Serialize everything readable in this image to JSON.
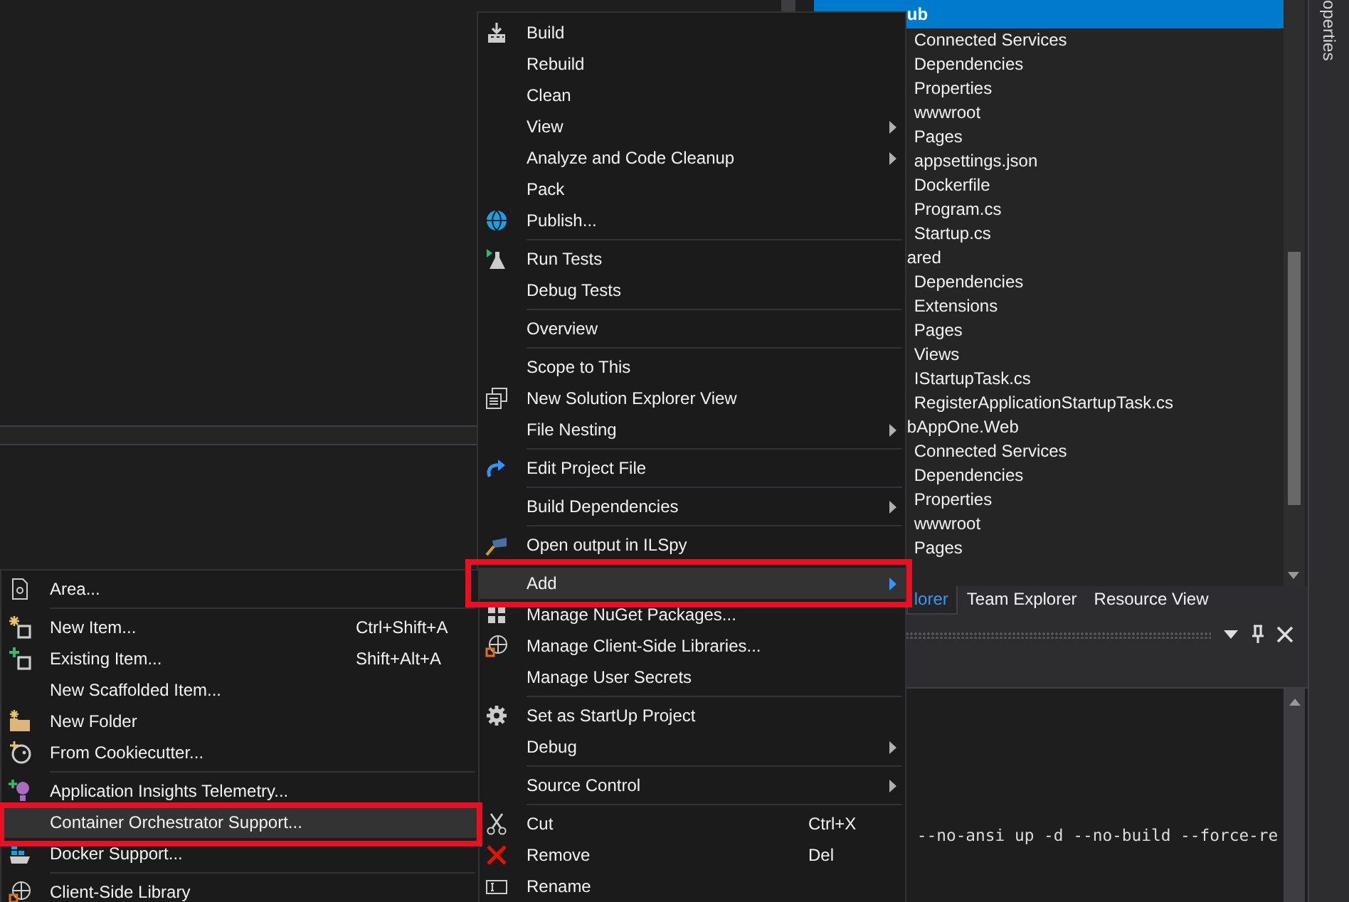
{
  "context_menu": {
    "items": [
      {
        "kind": "build",
        "label": "Build",
        "submenu": false,
        "selected": false,
        "annotated": false
      },
      {
        "kind": "plain",
        "label": "Rebuild",
        "submenu": false,
        "selected": false,
        "annotated": false
      },
      {
        "kind": "plain",
        "label": "Clean",
        "submenu": false,
        "selected": false,
        "annotated": false
      },
      {
        "kind": "plain",
        "label": "View",
        "submenu": true,
        "selected": false,
        "annotated": false
      },
      {
        "kind": "plain",
        "label": "Analyze and Code Cleanup",
        "submenu": true,
        "selected": false,
        "annotated": false
      },
      {
        "kind": "plain",
        "label": "Pack",
        "submenu": false,
        "selected": false,
        "annotated": false
      },
      {
        "kind": "globe",
        "label": "Publish...",
        "submenu": false,
        "selected": false,
        "annotated": false
      },
      {
        "kind": "separator"
      },
      {
        "kind": "flask",
        "label": "Run Tests",
        "submenu": false,
        "selected": false,
        "annotated": false
      },
      {
        "kind": "plain",
        "label": "Debug Tests",
        "submenu": false,
        "selected": false,
        "annotated": false
      },
      {
        "kind": "separator"
      },
      {
        "kind": "plain",
        "label": "Overview",
        "submenu": false,
        "selected": false,
        "annotated": false
      },
      {
        "kind": "separator"
      },
      {
        "kind": "plain",
        "label": "Scope to This",
        "submenu": false,
        "selected": false,
        "annotated": false
      },
      {
        "kind": "views",
        "label": "New Solution Explorer View",
        "submenu": false,
        "selected": false,
        "annotated": false
      },
      {
        "kind": "plain",
        "label": "File Nesting",
        "submenu": true,
        "selected": false,
        "annotated": false
      },
      {
        "kind": "separator"
      },
      {
        "kind": "arrow",
        "label": "Edit Project File",
        "submenu": false,
        "selected": false,
        "annotated": false
      },
      {
        "kind": "separator"
      },
      {
        "kind": "plain",
        "label": "Build Dependencies",
        "submenu": true,
        "selected": false,
        "annotated": false
      },
      {
        "kind": "separator"
      },
      {
        "kind": "spy",
        "label": "Open output in ILSpy",
        "submenu": false,
        "selected": false,
        "annotated": false
      },
      {
        "kind": "separator"
      },
      {
        "kind": "plain",
        "label": "Add",
        "submenu": true,
        "selected": true,
        "annotated": true
      },
      {
        "kind": "grid",
        "label": "Manage NuGet Packages...",
        "submenu": false,
        "selected": false,
        "annotated": false
      },
      {
        "kind": "webglobe",
        "label": "Manage Client-Side Libraries...",
        "submenu": false,
        "selected": false,
        "annotated": false
      },
      {
        "kind": "plain",
        "label": "Manage User Secrets",
        "submenu": false,
        "selected": false,
        "annotated": false
      },
      {
        "kind": "separator"
      },
      {
        "kind": "gear",
        "label": "Set as StartUp Project",
        "submenu": false,
        "selected": false,
        "annotated": false
      },
      {
        "kind": "plain",
        "label": "Debug",
        "submenu": true,
        "selected": false,
        "annotated": false
      },
      {
        "kind": "separator"
      },
      {
        "kind": "plain",
        "label": "Source Control",
        "submenu": true,
        "selected": false,
        "annotated": false
      },
      {
        "kind": "separator"
      },
      {
        "kind": "scissors",
        "label": "Cut",
        "shortcut": "Ctrl+X",
        "submenu": false,
        "selected": false,
        "annotated": false
      },
      {
        "kind": "cross",
        "label": "Remove",
        "shortcut": "Del",
        "submenu": false,
        "selected": false,
        "annotated": false
      },
      {
        "kind": "rename",
        "label": "Rename",
        "submenu": false,
        "selected": false,
        "annotated": false
      }
    ]
  },
  "add_submenu": {
    "items": [
      {
        "kind": "area",
        "label": "Area...",
        "submenu": false,
        "selected": false,
        "annotated": false
      },
      {
        "kind": "separator"
      },
      {
        "kind": "newitem",
        "label": "New Item...",
        "shortcut": "Ctrl+Shift+A",
        "submenu": false,
        "selected": false,
        "annotated": false
      },
      {
        "kind": "existing",
        "label": "Existing Item...",
        "shortcut": "Shift+Alt+A",
        "submenu": false,
        "selected": false,
        "annotated": false
      },
      {
        "kind": "plain",
        "label": "New Scaffolded Item...",
        "submenu": false,
        "selected": false,
        "annotated": false
      },
      {
        "kind": "folder",
        "label": "New Folder",
        "submenu": false,
        "selected": false,
        "annotated": false
      },
      {
        "kind": "cookie",
        "label": "From Cookiecutter...",
        "submenu": false,
        "selected": false,
        "annotated": false
      },
      {
        "kind": "separator"
      },
      {
        "kind": "insights",
        "label": "Application Insights Telemetry...",
        "submenu": false,
        "selected": false,
        "annotated": false
      },
      {
        "kind": "plain",
        "label": "Container Orchestrator Support...",
        "submenu": false,
        "selected": true,
        "annotated": true
      },
      {
        "kind": "docker",
        "label": "Docker Support...",
        "submenu": false,
        "selected": false,
        "annotated": false
      },
      {
        "kind": "separator"
      },
      {
        "kind": "webglobe",
        "label": "Client-Side Library",
        "submenu": false,
        "selected": false,
        "annotated": false
      }
    ]
  },
  "solution_explorer": {
    "items": [
      {
        "label": "ub",
        "selected": true,
        "children": [
          {
            "label": "Connected Services",
            "selected": false
          },
          {
            "label": "Dependencies",
            "selected": false
          },
          {
            "label": "Properties",
            "selected": false
          },
          {
            "label": "wwwroot",
            "selected": false
          },
          {
            "label": "Pages",
            "selected": false
          },
          {
            "label": "appsettings.json",
            "selected": false
          },
          {
            "label": "Dockerfile",
            "selected": false
          },
          {
            "label": "Program.cs",
            "selected": false
          },
          {
            "label": "Startup.cs",
            "selected": false
          }
        ]
      },
      {
        "label": "ared",
        "selected": false,
        "children": [
          {
            "label": "Dependencies",
            "selected": false
          },
          {
            "label": "Extensions",
            "selected": false
          },
          {
            "label": "Pages",
            "selected": false
          },
          {
            "label": "Views",
            "selected": false
          },
          {
            "label": "IStartupTask.cs",
            "selected": false
          },
          {
            "label": "RegisterApplicationStartupTask.cs",
            "selected": false
          }
        ]
      },
      {
        "label": "bAppOne.Web",
        "selected": false,
        "children": [
          {
            "label": "Connected Services",
            "selected": false
          },
          {
            "label": "Dependencies",
            "selected": false
          },
          {
            "label": "Properties",
            "selected": false
          },
          {
            "label": "wwwroot",
            "selected": false
          },
          {
            "label": "Pages",
            "selected": false
          }
        ]
      }
    ]
  },
  "panel_tabs": [
    {
      "label": "lorer",
      "selected": true
    },
    {
      "label": "Team Explorer",
      "selected": false
    },
    {
      "label": "Resource View",
      "selected": false
    }
  ],
  "output": {
    "lines": [
      "--no-ansi up -d --no-build --force-re"
    ]
  },
  "side_tab": {
    "label": "operties"
  }
}
